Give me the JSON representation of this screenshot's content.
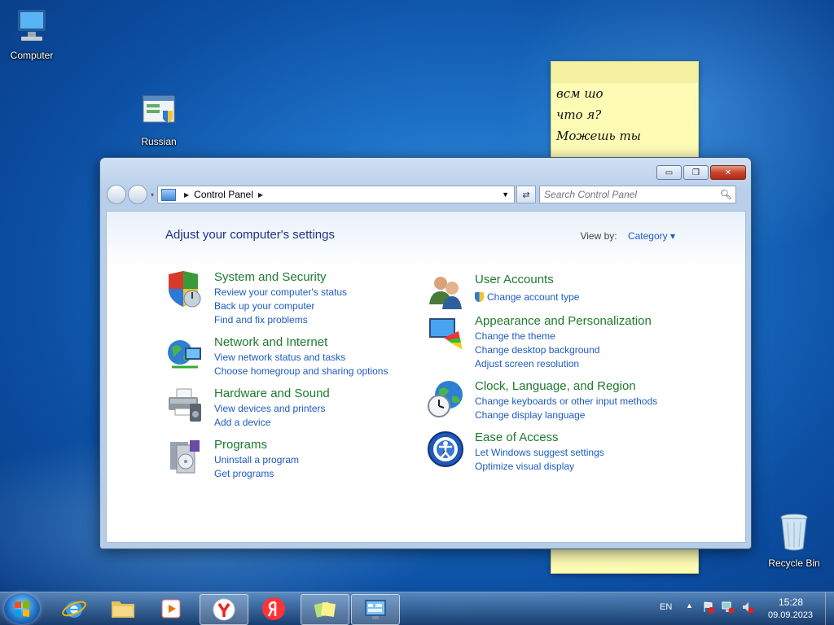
{
  "desktop": {
    "icons": [
      {
        "label": "Computer"
      },
      {
        "label": "Russian"
      },
      {
        "label": "Recycle Bin"
      }
    ]
  },
  "sticky_note": {
    "lines": [
      "всм шо",
      "что я?",
      "Можешь ты"
    ]
  },
  "window": {
    "address": {
      "segment": "Control Panel"
    },
    "search": {
      "placeholder": "Search Control Panel"
    },
    "caption": {
      "minimize": "▭",
      "maximize": "❐",
      "close": "✕"
    },
    "page_title": "Adjust your computer's settings",
    "view_by": {
      "label": "View by:",
      "value": "Category ▾"
    },
    "categories_left": [
      {
        "title": "System and Security",
        "icon": "shield-icon",
        "links": [
          "Review your computer's status",
          "Back up your computer",
          "Find and fix problems"
        ]
      },
      {
        "title": "Network and Internet",
        "icon": "globe-network-icon",
        "links": [
          "View network status and tasks",
          "Choose homegroup and sharing options"
        ]
      },
      {
        "title": "Hardware and Sound",
        "icon": "printer-icon",
        "links": [
          "View devices and printers",
          "Add a device"
        ]
      },
      {
        "title": "Programs",
        "icon": "programs-icon",
        "links": [
          "Uninstall a program",
          "Get programs"
        ]
      }
    ],
    "categories_right": [
      {
        "title": "User Accounts",
        "icon": "users-icon",
        "links": [
          "Change account type"
        ]
      },
      {
        "title": "Appearance and Personalization",
        "icon": "monitor-palette-icon",
        "links": [
          "Change the theme",
          "Change desktop background",
          "Adjust screen resolution"
        ]
      },
      {
        "title": "Clock, Language, and Region",
        "icon": "clock-globe-icon",
        "links": [
          "Change keyboards or other input methods",
          "Change display language"
        ]
      },
      {
        "title": "Ease of Access",
        "icon": "ease-of-access-icon",
        "links": [
          "Let Windows suggest settings",
          "Optimize visual display"
        ]
      }
    ]
  },
  "taskbar": {
    "items": [
      "internet-explorer-icon",
      "explorer-folder-icon",
      "media-player-icon",
      "yandex-browser-icon",
      "yandex-icon",
      "sticky-notes-icon",
      "control-panel-icon"
    ],
    "language": "EN",
    "time": "15:28",
    "date": "09.09.2023"
  },
  "colors": {
    "category_title": "#1e7a2e",
    "link": "#1e5bc0",
    "heading": "#1e3287"
  }
}
